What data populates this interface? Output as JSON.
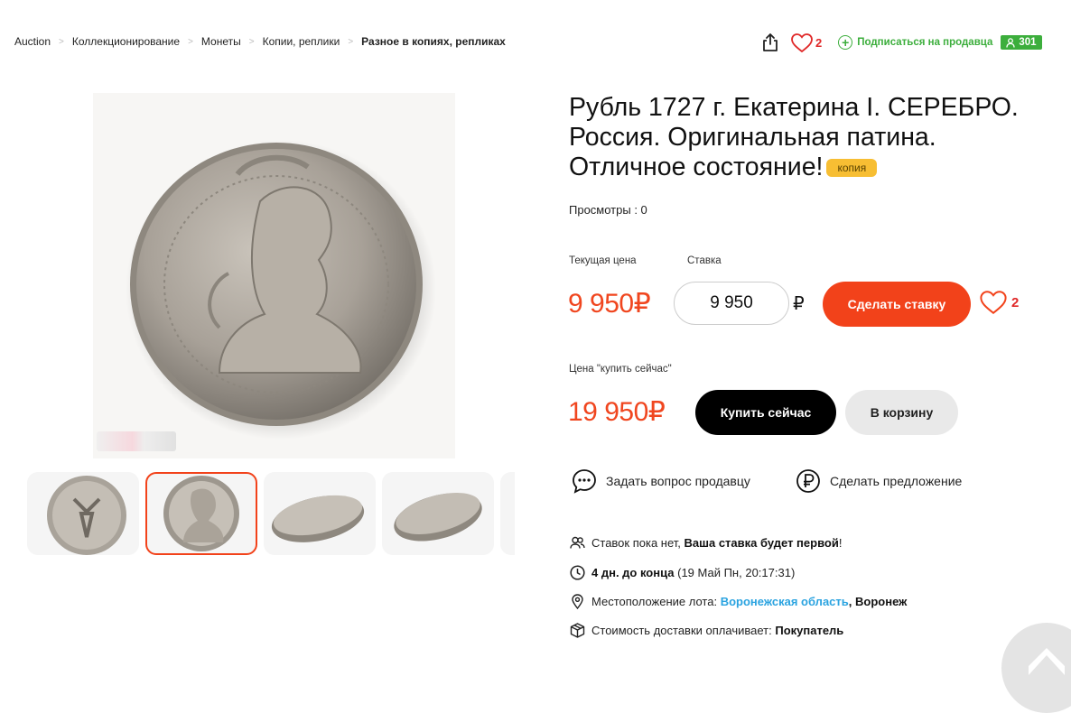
{
  "breadcrumb": [
    "Auction",
    "Коллекционирование",
    "Монеты",
    "Копии, реплики",
    "Разное в копиях, репликах"
  ],
  "header": {
    "favorites_count": "2",
    "subscribe_label": "Подписаться на продавца",
    "seller_rating": "301"
  },
  "lot": {
    "title": "Рубль 1727 г. Екатерина I. СЕРЕБРО. Россия. Оригинальная патина. Отличное состояние!",
    "badge": "копия",
    "views": "Просмотры : 0"
  },
  "bid": {
    "current_price_label": "Текущая цена",
    "current_price": "9 950₽",
    "stake_label": "Ставка",
    "stake_value": "9 950",
    "currency": "₽",
    "make_bid_label": "Сделать ставку",
    "favorites_count": "2"
  },
  "buy_now": {
    "label": "Цена \"купить сейчас\"",
    "price": "19 950₽",
    "buy_label": "Купить сейчас",
    "cart_label": "В корзину"
  },
  "actions": {
    "ask_seller": "Задать вопрос продавцу",
    "make_offer": "Сделать предложение"
  },
  "info": {
    "bids_text": "Ставок пока нет,",
    "bids_strong": "Ваша ставка будет первой",
    "bids_end": "!",
    "time_strong": "4 дн. до конца",
    "time_rest": "(19 Май Пн, 20:17:31)",
    "location_label": "Местоположение лота:",
    "location_region": "Воронежская область",
    "location_sep": ",",
    "location_city": "Воронеж",
    "delivery_label": "Стоимость доставки оплачивает:",
    "delivery_payer": "Покупатель"
  },
  "colors": {
    "accent": "#f2421a",
    "green": "#3cae3c",
    "link": "#2aa3e0",
    "badge": "#f7be33"
  }
}
